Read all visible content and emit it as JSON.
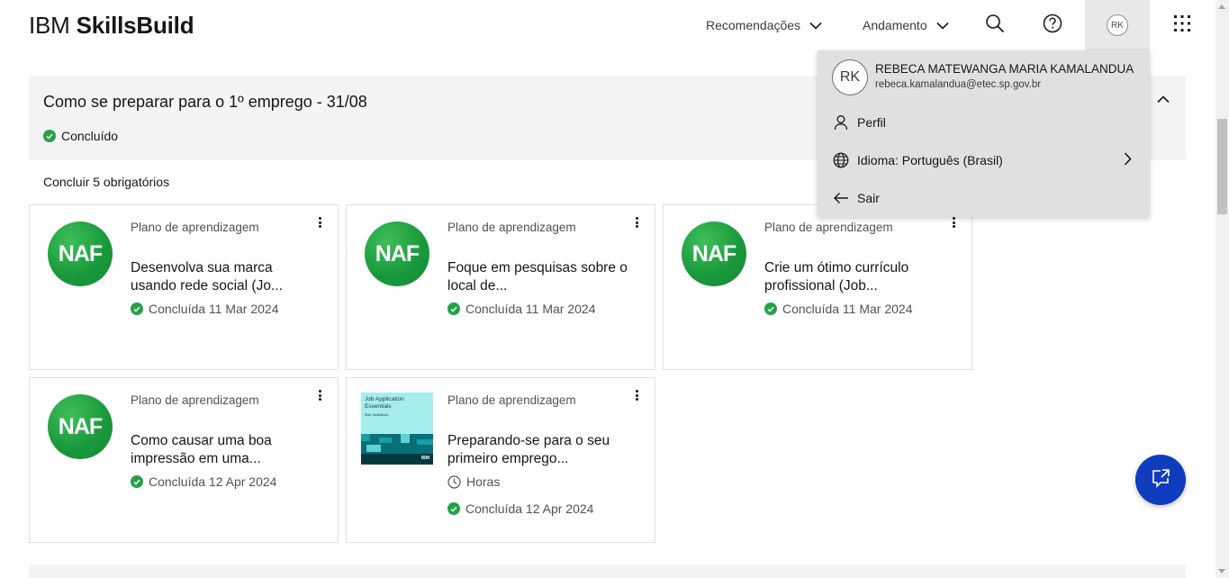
{
  "header": {
    "brand_light": "IBM",
    "brand_bold": "SkillsBuild",
    "nav": [
      {
        "label": "Recomendações"
      },
      {
        "label": "Andamento"
      }
    ],
    "avatar_initials": "RK"
  },
  "section": {
    "title": "Como se preparar para o 1º emprego - 31/08",
    "status": "Concluído",
    "requirement": "Concluir 5 obrigatórios"
  },
  "cards": [
    {
      "kind": "Plano de aprendizagem",
      "title": "Desenvolva sua marca usando rede social (Jo...",
      "completed": "Concluída 11 Mar 2024",
      "thumb_text": "NAF"
    },
    {
      "kind": "Plano de aprendizagem",
      "title": "Foque em pesquisas sobre o local de...",
      "completed": "Concluída 11 Mar 2024",
      "thumb_text": "NAF"
    },
    {
      "kind": "Plano de aprendizagem",
      "title": "Crie um ótimo currículo profissional (Job...",
      "completed": "Concluída 11 Mar 2024",
      "thumb_text": "NAF"
    },
    {
      "kind": "Plano de aprendizagem",
      "title": "Como causar uma boa impressão em uma...",
      "completed": "Concluída 12 Apr 2024",
      "thumb_text": "NAF"
    },
    {
      "kind": "Plano de aprendizagem",
      "title": "Preparando-se para o seu primeiro emprego...",
      "hours": "Horas",
      "completed": "Concluída 12 Apr 2024",
      "thumb_title": "Job Application Essentials",
      "thumb_sub": "IBM SkillsBuild",
      "thumb_brand": "IBM"
    }
  ],
  "profile_menu": {
    "initials": "RK",
    "name": "REBECA MATEWANGA MARIA KAMALANDUA",
    "email": "rebeca.kamalandua@etec.sp.gov.br",
    "items": [
      {
        "label": "Perfil",
        "icon": "user-icon"
      },
      {
        "label": "Idioma: Português (Brasil)",
        "icon": "globe-icon"
      },
      {
        "label": "Sair",
        "icon": "arrow-left-icon"
      }
    ]
  },
  "colors": {
    "success": "#24a148",
    "fab": "#0f3dbd",
    "section_bg": "#f4f4f4",
    "menu_bg": "#e0e0e0",
    "naf_green": "#1a9a3c"
  }
}
